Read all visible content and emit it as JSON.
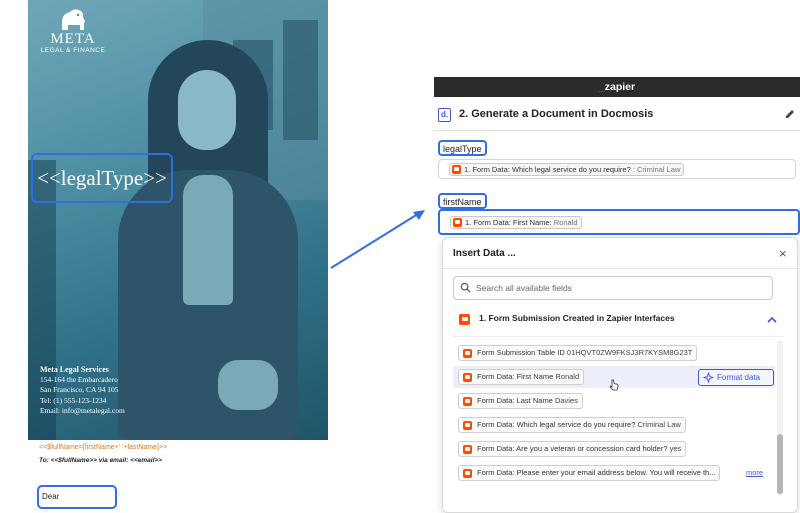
{
  "document": {
    "logo": {
      "name": "META",
      "subtitle": "LEGAL & FINANCE"
    },
    "legal_type_placeholder": "<<legalType>>",
    "address": {
      "company": "Meta Legal Services",
      "line1": "154-164 the Embarcadero",
      "line2": "San Francisco, CA 94 105",
      "tel": "Tel: (1) 555-123-1234",
      "email": "Email: info@metalegal.com"
    },
    "merge_line": "<<$fullName=[firstName+' '+lastName]>>",
    "to_line": "To: <<$fullName>> via email: <<email>>",
    "dear_line": "Dear <<firstName>>,"
  },
  "zapier": {
    "app_title_prefix": "_",
    "app_title": "zapier",
    "step_icon_letter": "d.",
    "step_title": "2. Generate a Document in Docmosis",
    "fields": [
      {
        "label": "legalType",
        "chip_label": "1. Form Data: Which legal service do you require?",
        "chip_value": ": Criminal Law"
      },
      {
        "label": "firstName",
        "chip_label": "1. Form Data: First Name:",
        "chip_value": "Ronald"
      }
    ],
    "insert_data": {
      "title": "Insert Data ...",
      "close": "×",
      "search_placeholder": "Search all available fields",
      "group_title": "1. Form Submission Created in Zapier Interfaces",
      "rows": [
        {
          "label": "Form Submission Table ID",
          "value": "01HQVT0ZW9FKSJ3R7KYSM8G23T"
        },
        {
          "label": "Form Data: First Name",
          "value": "Ronald"
        },
        {
          "label": "Form Data: Last Name",
          "value": "Davies"
        },
        {
          "label": "Form Data: Which legal service do you require?",
          "value": "Criminal Law"
        },
        {
          "label": "Form Data: Are you a veteran or concession card holder?",
          "value": "yes"
        },
        {
          "label": "Form Data: Please enter your email address below. You will receive th...",
          "value": ""
        }
      ],
      "format_button": "Format data",
      "more_link": "more"
    }
  },
  "colors": {
    "highlight_border": "#2f6fe0",
    "zapier_orange": "#ff4a00",
    "docmosis_blue": "#3b57d6",
    "merge_orange": "#e07820"
  }
}
